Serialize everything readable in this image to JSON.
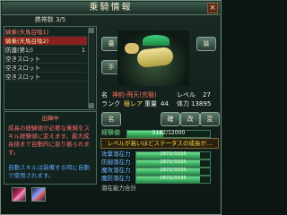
{
  "window": {
    "title": "乗騎情報",
    "close": "×"
  },
  "list": {
    "count_label": "携帯数 3/5",
    "rows": [
      {
        "label": "騎乗(天馬召喚1)",
        "num": "",
        "state": "red"
      },
      {
        "label": "騎乗(天馬召喚2)",
        "num": "",
        "state": "sel"
      },
      {
        "label": "防護(第1/)",
        "num": "1",
        "state": ""
      },
      {
        "label": "空きスロット",
        "num": "",
        "state": ""
      },
      {
        "label": "空きスロット",
        "num": "",
        "state": ""
      },
      {
        "label": "空きスロット",
        "num": "",
        "state": ""
      }
    ]
  },
  "desc": {
    "heading": "出陣中",
    "body": "成長の経験値が必要な乗騎をスキル経験値に変えます。最大成長値まで自動的に割り振られます。",
    "blue": "自動スキルは装備する時に自動で使用されます。"
  },
  "actions": {
    "ride": "乗",
    "equip": "装",
    "release": "手",
    "name": "名",
    "btn_a": "確",
    "btn_b": "改",
    "btn_c": "変"
  },
  "mount": {
    "name_label": "名",
    "name": "神約·飛天(究極)",
    "level_label": "レベル",
    "level": "27",
    "rank_label": "ランク",
    "rank": "極レア",
    "loyalty_label": "重量",
    "loyalty": "44",
    "hp_label": "体力",
    "hp": "13895"
  },
  "exp": {
    "label": "経験値",
    "text": "5182/12000",
    "fraction": 0.43
  },
  "notice": "レベルが高いほどステータスの成長が…",
  "stats": [
    {
      "label": "攻撃潜在力",
      "text": "2872/3335",
      "fraction": 0.86
    },
    {
      "label": "防御潜在力",
      "text": "2872/3335",
      "fraction": 0.86
    },
    {
      "label": "魔攻潜在力",
      "text": "2872/3335",
      "fraction": 0.86
    },
    {
      "label": "魔防潜在力",
      "text": "2872/3335",
      "fraction": 0.86
    }
  ],
  "footer": "潜在能力合計"
}
